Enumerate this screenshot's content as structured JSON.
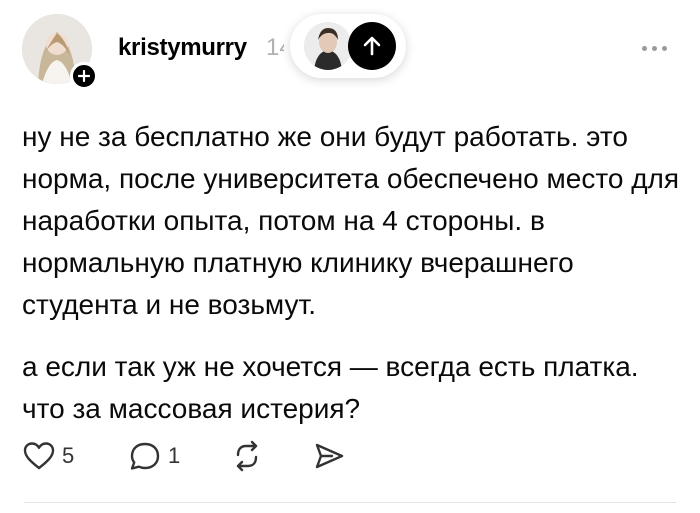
{
  "post": {
    "username": "kristymurry",
    "time_partial": "14",
    "paragraphs": [
      "ну не за бесплатно же они будут работать. это норма, после университета обеспечено место для наработки опыта, потом на 4 стороны. в нормальную платную клинику вчерашнего студента и не возьмут.",
      "а если так уж не хочется — всегда есть платка. что за массовая истерия?"
    ]
  },
  "actions": {
    "likes": "5",
    "replies": "1"
  },
  "icons": {
    "follow": "plus-icon",
    "scroll_top": "arrow-up-icon",
    "more": "more-horizontal-icon",
    "like": "heart-icon",
    "reply": "comment-icon",
    "repost": "repost-icon",
    "share": "send-icon"
  }
}
